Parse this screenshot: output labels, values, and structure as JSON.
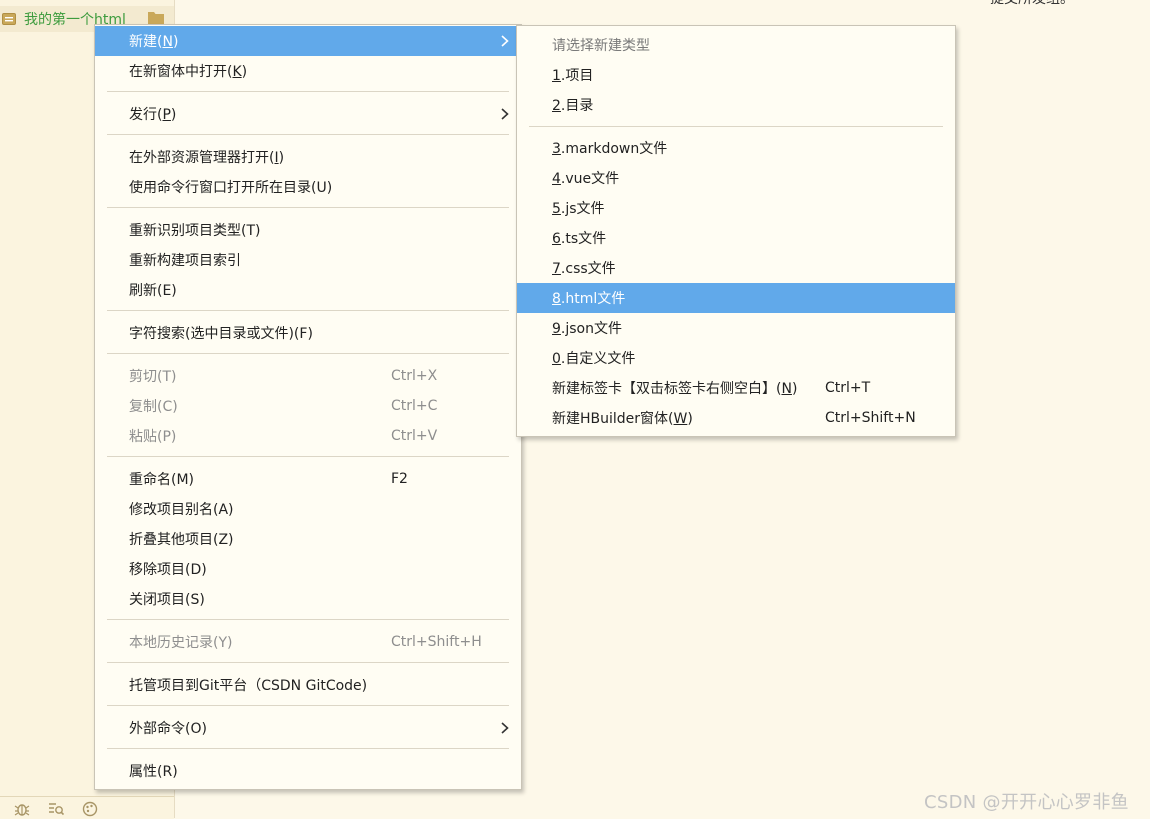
{
  "project_panel": {
    "project_name": "我的第一个html"
  },
  "top_snippet": "提交所发组。",
  "main_menu": {
    "new": {
      "label": "新建(",
      "key": "N",
      "close": ")"
    },
    "open_new_window": {
      "label": "在新窗体中打开(",
      "key": "K",
      "close": ")"
    },
    "publish": {
      "label": "发行(",
      "key": "P",
      "close": ")"
    },
    "open_in_explorer": {
      "label": "在外部资源管理器打开(",
      "key": "I",
      "close": ")"
    },
    "open_cmd": {
      "label": "使用命令行窗口打开所在目录(U)"
    },
    "reidentify": {
      "label": "重新识别项目类型(T)"
    },
    "rebuild_index": {
      "label": "重新构建项目索引"
    },
    "refresh": {
      "label": "刷新(E)"
    },
    "char_search": {
      "label": "字符搜索(选中目录或文件)(F)"
    },
    "cut": {
      "label": "剪切(T)",
      "shortcut": "Ctrl+X"
    },
    "copy": {
      "label": "复制(C)",
      "shortcut": "Ctrl+C"
    },
    "paste": {
      "label": "粘贴(P)",
      "shortcut": "Ctrl+V"
    },
    "rename": {
      "label": "重命名(M)",
      "shortcut": "F2"
    },
    "alias": {
      "label": "修改项目别名(A)"
    },
    "fold_others": {
      "label": "折叠其他项目(Z)"
    },
    "remove": {
      "label": "移除项目(D)"
    },
    "close": {
      "label": "关闭项目(S)"
    },
    "history": {
      "label": "本地历史记录(Y)",
      "shortcut": "Ctrl+Shift+H"
    },
    "git_host": {
      "label": "托管项目到Git平台（CSDN GitCode)"
    },
    "external_cmd": {
      "label": "外部命令(O)"
    },
    "properties": {
      "label": "属性(R)"
    }
  },
  "sub_menu": {
    "header": "请选择新建类型",
    "items": [
      {
        "key": "1",
        "rest": ".项目"
      },
      {
        "key": "2",
        "rest": ".目录"
      },
      {
        "key": "3",
        "rest": ".markdown文件"
      },
      {
        "key": "4",
        "rest": ".vue文件"
      },
      {
        "key": "5",
        "rest": ".js文件"
      },
      {
        "key": "6",
        "rest": ".ts文件"
      },
      {
        "key": "7",
        "rest": ".css文件"
      },
      {
        "key": "8",
        "rest": ".html文件"
      },
      {
        "key": "9",
        "rest": ".json文件"
      },
      {
        "key": "0",
        "rest": ".自定义文件"
      }
    ],
    "new_tab": {
      "label": "新建标签卡【双击标签卡右侧空白】(",
      "key": "N",
      "close": ")",
      "shortcut": "Ctrl+T"
    },
    "new_window": {
      "label": "新建HBuilder窗体(",
      "key": "W",
      "close": ")",
      "shortcut": "Ctrl+Shift+N"
    }
  },
  "watermark": "CSDN @开开心心罗非鱼",
  "colors": {
    "background": "#fdf8e9",
    "menu_bg": "#fffdf3",
    "highlight": "#61a9ea",
    "project_name": "#3e9c3e",
    "disabled": "#8e8e8e"
  }
}
